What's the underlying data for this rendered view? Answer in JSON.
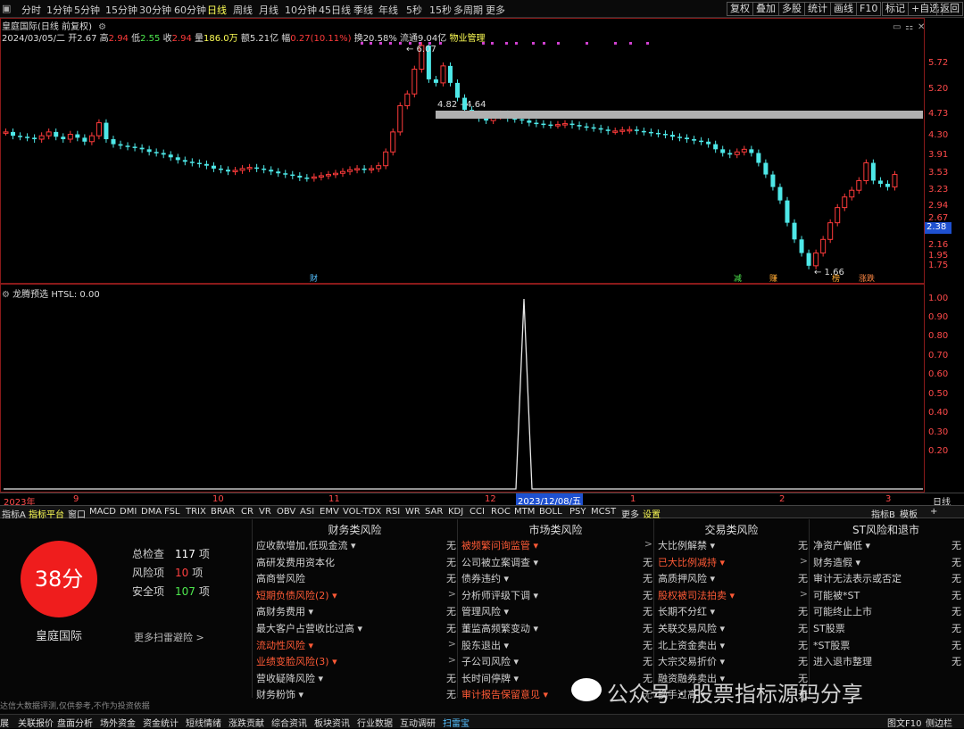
{
  "toolbar": {
    "periods": [
      "分时",
      "1分钟",
      "5分钟",
      "15分钟",
      "30分钟",
      "60分钟",
      "日线",
      "周线",
      "月线",
      "10分钟",
      "45日线",
      "季线",
      "年线",
      "5秒",
      "15秒",
      "多周期",
      "更多"
    ],
    "active_period": "日线",
    "right_buttons": [
      "复权",
      "叠加",
      "多股",
      "统计",
      "画线",
      "F10",
      "标记",
      "+自选",
      "返回"
    ]
  },
  "info": {
    "line1": "皇庭国际(日线 前复权)",
    "date": "2024/03/05/二",
    "open_label": "开",
    "open": "2.67",
    "high_label": "高",
    "high": "2.94",
    "low_label": "低",
    "low": "2.55",
    "close_label": "收",
    "close": "2.94",
    "vol_label": "量",
    "vol": "186.0万",
    "amt_label": "额",
    "amt": "5.21亿",
    "chg_label": "幅",
    "chg": "0.27(10.11%)",
    "turn_label": "换",
    "turn": "20.58%",
    "float_label": "流通",
    "float": "9.04亿",
    "sector": "物业管理"
  },
  "price_axis": [
    "5.72",
    "5.20",
    "4.73",
    "4.30",
    "3.91",
    "3.53",
    "3.23",
    "2.94",
    "2.67",
    "2.38",
    "2.16",
    "1.95",
    "1.75"
  ],
  "chart_annotations": {
    "peak": "6.07",
    "gap_range": "4.82 - 4.64",
    "low": "1.66",
    "current_price": "2.38",
    "markers": [
      "财",
      "减",
      "赚",
      "榜",
      "涨跌"
    ]
  },
  "indicator": {
    "title": "龙腾预选 HTSL: 0.00",
    "axis": [
      "1.00",
      "0.90",
      "0.80",
      "0.70",
      "0.60",
      "0.50",
      "0.40",
      "0.30",
      "0.20"
    ]
  },
  "date_axis": {
    "labels": [
      "2023年",
      "9",
      "10",
      "11",
      "12",
      "1",
      "2",
      "3"
    ],
    "cursor": "2023/12/08/五",
    "right_label": "日线"
  },
  "indicator_tabs": [
    "指标A",
    "指标平台",
    "窗口",
    "MACD",
    "DMI",
    "DMA",
    "FSL",
    "TRIX",
    "BRAR",
    "CR",
    "VR",
    "OBV",
    "ASI",
    "EMV",
    "VOL-TDX",
    "RSI",
    "WR",
    "SAR",
    "KDJ",
    "CCI",
    "ROC",
    "MTM",
    "BOLL",
    "PSY",
    "MCST",
    "更多",
    "设置"
  ],
  "indicator_tabs_right": [
    "指标B",
    "模板",
    "+"
  ],
  "scan": {
    "score": "38分",
    "total_label": "总检查",
    "total": "117",
    "unit": "项",
    "risk_label": "风险项",
    "risk": "10",
    "safe_label": "安全项",
    "safe": "107",
    "stock_name": "皇庭国际",
    "more_link": "更多扫雷避险 >",
    "disclaimer": "达信大数据评测,仅供参考,不作为投资依据"
  },
  "risk_columns": [
    {
      "title": "财务类风险",
      "items": [
        {
          "label": "应收款增加,低现金流 ▾",
          "status": "无",
          "hl": false
        },
        {
          "label": "高研发费用资本化",
          "status": "无",
          "hl": false
        },
        {
          "label": "高商誉风险",
          "status": "无",
          "hl": false
        },
        {
          "label": "短期负债风险(2) ▾",
          "status": ">",
          "hl": true
        },
        {
          "label": "高财务费用 ▾",
          "status": "无",
          "hl": false
        },
        {
          "label": "最大客户占营收比过高 ▾",
          "status": "无",
          "hl": false
        },
        {
          "label": "流动性风险 ▾",
          "status": ">",
          "hl": true
        },
        {
          "label": "业绩变脸风险(3) ▾",
          "status": ">",
          "hl": true
        },
        {
          "label": "营收疑降风险 ▾",
          "status": "无",
          "hl": false
        },
        {
          "label": "财务粉饰 ▾",
          "status": "无",
          "hl": false
        }
      ]
    },
    {
      "title": "市场类风险",
      "items": [
        {
          "label": "被频繁问询监管 ▾",
          "status": ">",
          "hl": true
        },
        {
          "label": "公司被立案调查 ▾",
          "status": "无",
          "hl": false
        },
        {
          "label": "债券违约 ▾",
          "status": "无",
          "hl": false
        },
        {
          "label": "分析师评级下调 ▾",
          "status": "无",
          "hl": false
        },
        {
          "label": "管理风险 ▾",
          "status": "无",
          "hl": false
        },
        {
          "label": "董监高频繁变动 ▾",
          "status": "无",
          "hl": false
        },
        {
          "label": "股东退出 ▾",
          "status": "无",
          "hl": false
        },
        {
          "label": "子公司风险 ▾",
          "status": "无",
          "hl": false
        },
        {
          "label": "长时间停牌 ▾",
          "status": "无",
          "hl": false
        },
        {
          "label": "审计报告保留意见 ▾",
          "status": "无",
          "hl": true
        }
      ]
    },
    {
      "title": "交易类风险",
      "items": [
        {
          "label": "大比例解禁 ▾",
          "status": "无",
          "hl": false
        },
        {
          "label": "已大比例减持 ▾",
          "status": ">",
          "hl": true
        },
        {
          "label": "高质押风险 ▾",
          "status": "无",
          "hl": false
        },
        {
          "label": "股权被司法拍卖 ▾",
          "status": ">",
          "hl": true
        },
        {
          "label": "长期不分红 ▾",
          "status": "无",
          "hl": false
        },
        {
          "label": "关联交易风险 ▾",
          "status": "无",
          "hl": false
        },
        {
          "label": "北上资金卖出 ▾",
          "status": "无",
          "hl": false
        },
        {
          "label": "大宗交易折价 ▾",
          "status": "无",
          "hl": false
        },
        {
          "label": "融资融券卖出 ▾",
          "status": "无",
          "hl": false
        },
        {
          "label": "换手过高 ▾",
          "status": "无",
          "hl": false
        }
      ]
    },
    {
      "title": "ST风险和退市",
      "items": [
        {
          "label": "净资产偏低 ▾",
          "status": "无",
          "hl": false
        },
        {
          "label": "财务造假 ▾",
          "status": "无",
          "hl": false
        },
        {
          "label": "审计无法表示或否定",
          "status": "无",
          "hl": false
        },
        {
          "label": "可能被*ST",
          "status": "无",
          "hl": false
        },
        {
          "label": "可能终止上市",
          "status": "无",
          "hl": false
        },
        {
          "label": "ST股票",
          "status": "无",
          "hl": false
        },
        {
          "label": "*ST股票",
          "status": "无",
          "hl": false
        },
        {
          "label": "进入退市整理",
          "status": "无",
          "hl": false
        }
      ]
    }
  ],
  "bottom_tabs": [
    "展",
    "关联报价",
    "盘面分析",
    "场外资金",
    "资金统计",
    "短线情绪",
    "涨跌贡献",
    "综合资讯",
    "板块资讯",
    "行业数据",
    "互动调研",
    "扫雷宝"
  ],
  "bottom_active": "扫雷宝",
  "bottom_right": [
    "图文F10",
    "侧边栏"
  ],
  "watermark": "公众号 · 股票指标源码分享",
  "colors": {
    "up": "#ff3b3b",
    "down": "#4ee8e8",
    "accent": "#ffff55",
    "gap": "#b0b0b0"
  }
}
